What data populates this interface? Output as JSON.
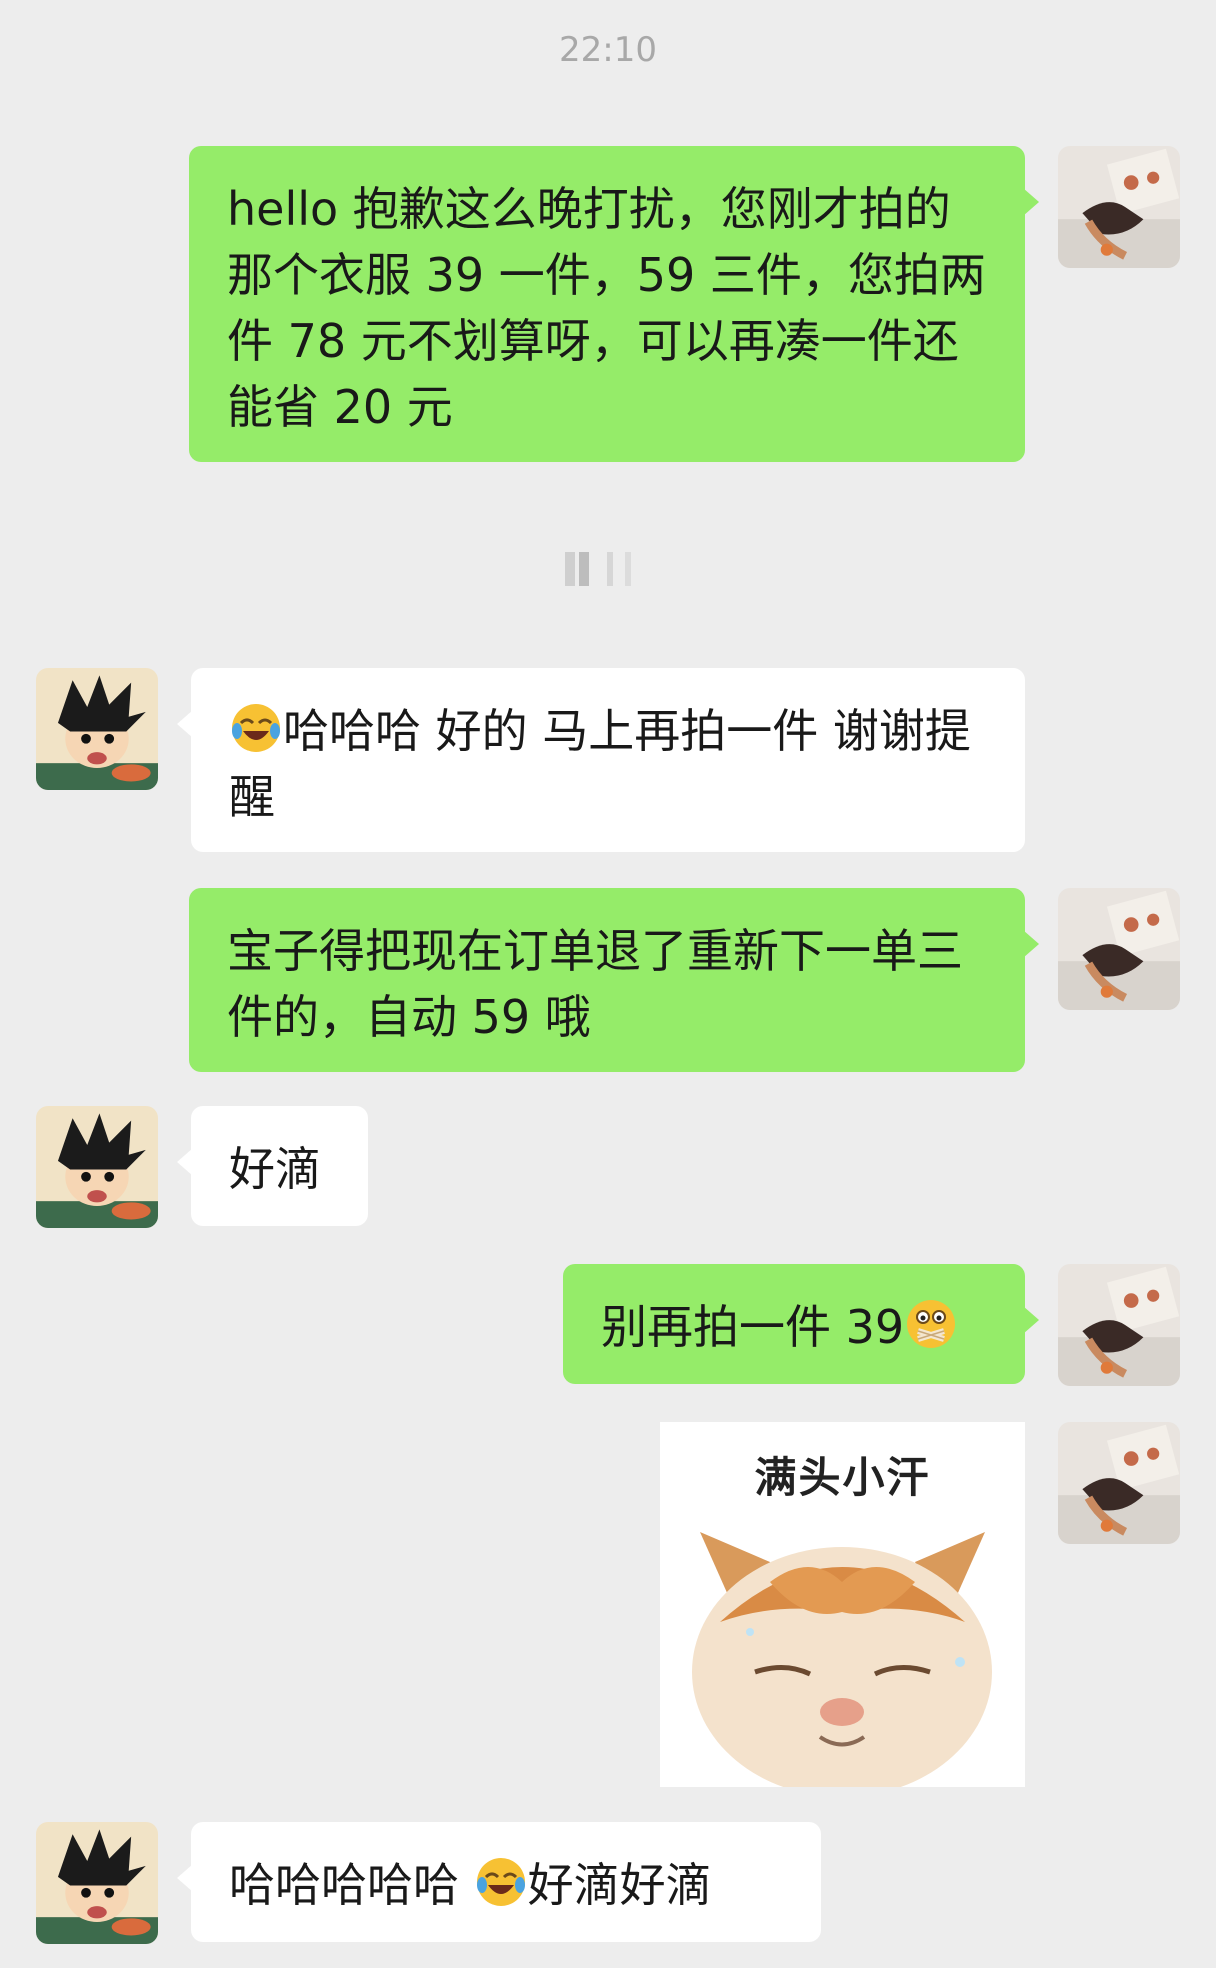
{
  "header": {
    "timestamp": "22:10"
  },
  "messages": [
    {
      "sender": "self",
      "text": "hello 抱歉这么晚打扰，您刚才拍的那个衣服 39 一件，59 三件，您拍两件 78 元不划算呀，可以再凑一件还能省 20 元"
    },
    {
      "sender": "other",
      "emoji": "face-with-tears-of-joy",
      "text": "哈哈哈  好的  马上再拍一件  谢谢提醒"
    },
    {
      "sender": "self",
      "text": "宝子得把现在订单退了重新下一单三件的，自动 59 哦"
    },
    {
      "sender": "other",
      "text": "好滴"
    },
    {
      "sender": "self",
      "text": "别再拍一件 39",
      "emoji": "zipper-mouth-face"
    },
    {
      "sender": "self",
      "type": "sticker",
      "caption": "满头小汗",
      "icon": "sweating-cat-sticker"
    },
    {
      "sender": "other",
      "text_before": "哈哈哈哈哈  ",
      "emoji": "face-with-tears-of-joy",
      "text_after": "好滴好滴"
    }
  ],
  "colors": {
    "self_bubble": "#95ec69",
    "other_bubble": "#ffffff",
    "background": "#ededed"
  }
}
